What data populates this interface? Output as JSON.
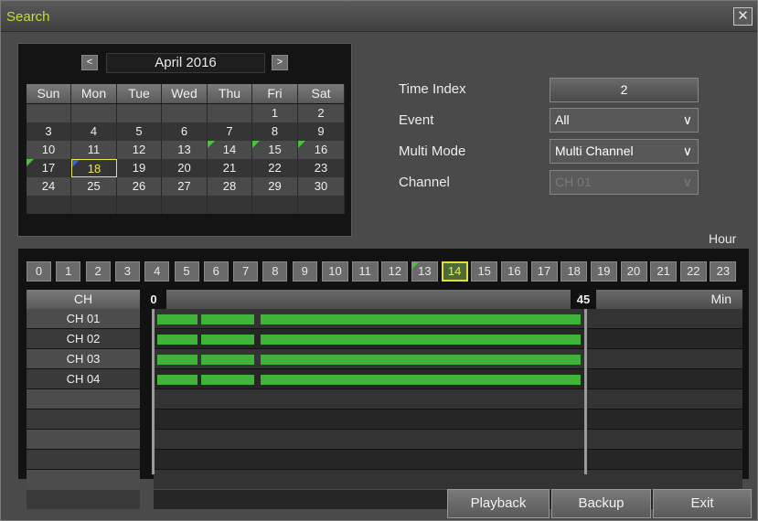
{
  "window": {
    "title": "Search",
    "close_glyph": "✕"
  },
  "calendar": {
    "month_label": "April 2016",
    "prev_glyph": "<",
    "next_glyph": ">",
    "weekdays": [
      "Sun",
      "Mon",
      "Tue",
      "Wed",
      "Thu",
      "Fri",
      "Sat"
    ],
    "weeks": [
      [
        "",
        "",
        "",
        "",
        "",
        "1",
        "2"
      ],
      [
        "3",
        "4",
        "5",
        "6",
        "7",
        "8",
        "9"
      ],
      [
        "10",
        "11",
        "12",
        "13",
        "14",
        "15",
        "16"
      ],
      [
        "17",
        "18",
        "19",
        "20",
        "21",
        "22",
        "23"
      ],
      [
        "24",
        "25",
        "26",
        "27",
        "28",
        "29",
        "30"
      ],
      [
        "",
        "",
        "",
        "",
        "",
        "",
        ""
      ]
    ],
    "selected_day": "18",
    "days_with_data": [
      "14",
      "15",
      "16",
      "17"
    ],
    "today_marker_day": "18",
    "marker_colors": {
      "data": "#4cc23c",
      "today": "#3c5ce8",
      "selected": "#e7e64e"
    }
  },
  "form": {
    "time_index": {
      "label": "Time Index",
      "value": "2"
    },
    "event": {
      "label": "Event",
      "value": "All"
    },
    "multi_mode": {
      "label": "Multi Mode",
      "value": "Multi Channel"
    },
    "channel": {
      "label": "Channel",
      "value": "CH 01",
      "disabled": true
    }
  },
  "timeline": {
    "hour_label": "Hour",
    "hours": [
      "0",
      "1",
      "2",
      "3",
      "4",
      "5",
      "6",
      "7",
      "8",
      "9",
      "10",
      "11",
      "12",
      "13",
      "14",
      "15",
      "16",
      "17",
      "18",
      "19",
      "20",
      "21",
      "22",
      "23"
    ],
    "current_hour": "14",
    "hours_with_data": [
      "13",
      "14"
    ],
    "ch_header": "CH",
    "minute_start": "0",
    "minute_cursor": "45",
    "minute_unit": "Min",
    "channels": [
      "CH 01",
      "CH 02",
      "CH 03",
      "CH 04"
    ],
    "empty_rows": 4,
    "recording_minutes": [
      [
        0,
        3.9
      ],
      [
        4.3,
        9.4
      ],
      [
        10,
        41.1
      ]
    ],
    "bar_color": "#41b23a"
  },
  "buttons": {
    "playback": "Playback",
    "backup": "Backup",
    "exit": "Exit"
  }
}
